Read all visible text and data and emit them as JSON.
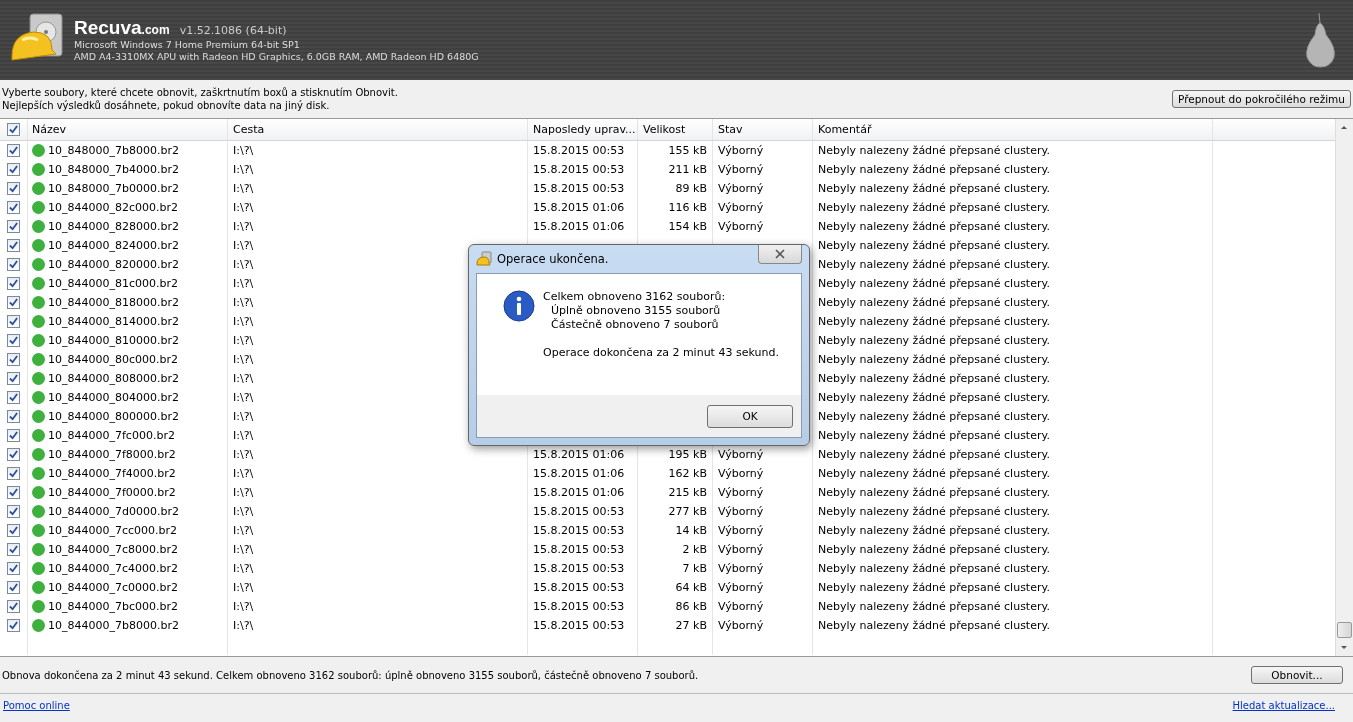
{
  "header": {
    "brand": "Recuva",
    "brand_suffix": ".com",
    "version": "v1.52.1086 (64-bit)",
    "os": "Microsoft Windows 7 Home Premium 64-bit SP1",
    "hardware": "AMD A4-3310MX APU with Radeon HD Graphics, 6.0GB RAM, AMD Radeon HD 6480G"
  },
  "instructions": [
    "Vyberte soubory, které chcete obnovit, zaškrtnutím boxů a stisknutím Obnovit.",
    "Nejlepších výsledků dosáhnete, pokud obnovíte data na jiný disk."
  ],
  "advanced_button": "Přepnout do pokročilého režimu",
  "table": {
    "all_checked": true,
    "columns": [
      "Název",
      "Cesta",
      "Naposledy uprav...",
      "Velikost",
      "Stav",
      "Komentář"
    ],
    "rows": [
      {
        "checked": true,
        "name": "10_848000_7b8000.br2",
        "path": "I:\\?\\",
        "date": "15.8.2015 00:53",
        "size": "155 kB",
        "state": "Výborný",
        "comment": "Nebyly nalezeny žádné přepsané clustery.",
        "color": "#3db03d"
      },
      {
        "checked": true,
        "name": "10_848000_7b4000.br2",
        "path": "I:\\?\\",
        "date": "15.8.2015 00:53",
        "size": "211 kB",
        "state": "Výborný",
        "comment": "Nebyly nalezeny žádné přepsané clustery.",
        "color": "#3db03d"
      },
      {
        "checked": true,
        "name": "10_848000_7b0000.br2",
        "path": "I:\\?\\",
        "date": "15.8.2015 00:53",
        "size": "89 kB",
        "state": "Výborný",
        "comment": "Nebyly nalezeny žádné přepsané clustery.",
        "color": "#3db03d"
      },
      {
        "checked": true,
        "name": "10_844000_82c000.br2",
        "path": "I:\\?\\",
        "date": "15.8.2015 01:06",
        "size": "116 kB",
        "state": "Výborný",
        "comment": "Nebyly nalezeny žádné přepsané clustery.",
        "color": "#3db03d"
      },
      {
        "checked": true,
        "name": "10_844000_828000.br2",
        "path": "I:\\?\\",
        "date": "15.8.2015 01:06",
        "size": "154 kB",
        "state": "Výborný",
        "comment": "Nebyly nalezeny žádné přepsané clustery.",
        "color": "#3db03d"
      },
      {
        "checked": true,
        "name": "10_844000_824000.br2",
        "path": "I:\\?\\",
        "comment": "Nebyly nalezeny žádné přepsané clustery.",
        "color": "#3db03d"
      },
      {
        "checked": true,
        "name": "10_844000_820000.br2",
        "path": "I:\\?\\",
        "comment": "Nebyly nalezeny žádné přepsané clustery.",
        "color": "#3db03d"
      },
      {
        "checked": true,
        "name": "10_844000_81c000.br2",
        "path": "I:\\?\\",
        "comment": "Nebyly nalezeny žádné přepsané clustery.",
        "color": "#3db03d"
      },
      {
        "checked": true,
        "name": "10_844000_818000.br2",
        "path": "I:\\?\\",
        "comment": "Nebyly nalezeny žádné přepsané clustery.",
        "color": "#3db03d"
      },
      {
        "checked": true,
        "name": "10_844000_814000.br2",
        "path": "I:\\?\\",
        "comment": "Nebyly nalezeny žádné přepsané clustery.",
        "color": "#3db03d"
      },
      {
        "checked": true,
        "name": "10_844000_810000.br2",
        "path": "I:\\?\\",
        "comment": "Nebyly nalezeny žádné přepsané clustery.",
        "color": "#3db03d"
      },
      {
        "checked": true,
        "name": "10_844000_80c000.br2",
        "path": "I:\\?\\",
        "comment": "Nebyly nalezeny žádné přepsané clustery.",
        "color": "#3db03d"
      },
      {
        "checked": true,
        "name": "10_844000_808000.br2",
        "path": "I:\\?\\",
        "comment": "Nebyly nalezeny žádné přepsané clustery.",
        "color": "#3db03d"
      },
      {
        "checked": true,
        "name": "10_844000_804000.br2",
        "path": "I:\\?\\",
        "comment": "Nebyly nalezeny žádné přepsané clustery.",
        "color": "#3db03d"
      },
      {
        "checked": true,
        "name": "10_844000_800000.br2",
        "path": "I:\\?\\",
        "comment": "Nebyly nalezeny žádné přepsané clustery.",
        "color": "#3db03d"
      },
      {
        "checked": true,
        "name": "10_844000_7fc000.br2",
        "path": "I:\\?\\",
        "comment": "Nebyly nalezeny žádné přepsané clustery.",
        "color": "#3db03d"
      },
      {
        "checked": true,
        "name": "10_844000_7f8000.br2",
        "path": "I:\\?\\",
        "date": "15.8.2015 01:06",
        "size": "195 kB",
        "state": "Výborný",
        "comment": "Nebyly nalezeny žádné přepsané clustery.",
        "color": "#3db03d"
      },
      {
        "checked": true,
        "name": "10_844000_7f4000.br2",
        "path": "I:\\?\\",
        "date": "15.8.2015 01:06",
        "size": "162 kB",
        "state": "Výborný",
        "comment": "Nebyly nalezeny žádné přepsané clustery.",
        "color": "#3db03d"
      },
      {
        "checked": true,
        "name": "10_844000_7f0000.br2",
        "path": "I:\\?\\",
        "date": "15.8.2015 01:06",
        "size": "215 kB",
        "state": "Výborný",
        "comment": "Nebyly nalezeny žádné přepsané clustery.",
        "color": "#3db03d"
      },
      {
        "checked": true,
        "name": "10_844000_7d0000.br2",
        "path": "I:\\?\\",
        "date": "15.8.2015 00:53",
        "size": "277 kB",
        "state": "Výborný",
        "comment": "Nebyly nalezeny žádné přepsané clustery.",
        "color": "#3db03d"
      },
      {
        "checked": true,
        "name": "10_844000_7cc000.br2",
        "path": "I:\\?\\",
        "date": "15.8.2015 00:53",
        "size": "14 kB",
        "state": "Výborný",
        "comment": "Nebyly nalezeny žádné přepsané clustery.",
        "color": "#3db03d"
      },
      {
        "checked": true,
        "name": "10_844000_7c8000.br2",
        "path": "I:\\?\\",
        "date": "15.8.2015 00:53",
        "size": "2 kB",
        "state": "Výborný",
        "comment": "Nebyly nalezeny žádné přepsané clustery.",
        "color": "#3db03d"
      },
      {
        "checked": true,
        "name": "10_844000_7c4000.br2",
        "path": "I:\\?\\",
        "date": "15.8.2015 00:53",
        "size": "7 kB",
        "state": "Výborný",
        "comment": "Nebyly nalezeny žádné přepsané clustery.",
        "color": "#3db03d"
      },
      {
        "checked": true,
        "name": "10_844000_7c0000.br2",
        "path": "I:\\?\\",
        "date": "15.8.2015 00:53",
        "size": "64 kB",
        "state": "Výborný",
        "comment": "Nebyly nalezeny žádné přepsané clustery.",
        "color": "#3db03d"
      },
      {
        "checked": true,
        "name": "10_844000_7bc000.br2",
        "path": "I:\\?\\",
        "date": "15.8.2015 00:53",
        "size": "86 kB",
        "state": "Výborný",
        "comment": "Nebyly nalezeny žádné přepsané clustery.",
        "color": "#3db03d"
      },
      {
        "checked": true,
        "name": "10_844000_7b8000.br2",
        "path": "I:\\?\\",
        "date": "15.8.2015 00:53",
        "size": "27 kB",
        "state": "Výborný",
        "comment": "Nebyly nalezeny žádné přepsané clustery.",
        "color": "#3db03d"
      }
    ]
  },
  "status_text": "Obnova dokončena za 2 minut 43 sekund. Celkem obnoveno 3162 souborů: úplně obnoveno 3155 souborů, částečně obnoveno 7 souborů.",
  "recover_button": "Obnovit...",
  "footer": {
    "help_link": "Pomoc online",
    "update_link": "Hledat aktualizace..."
  },
  "dialog": {
    "title": "Operace ukončena.",
    "lines": [
      "Celkem obnoveno 3162 souborů:",
      "Úplně obnoveno 3155 souborů",
      "Částečně obnoveno 7 souborů"
    ],
    "summary": "Operace dokončena za 2 minut 43 sekund.",
    "ok_button": "OK"
  }
}
